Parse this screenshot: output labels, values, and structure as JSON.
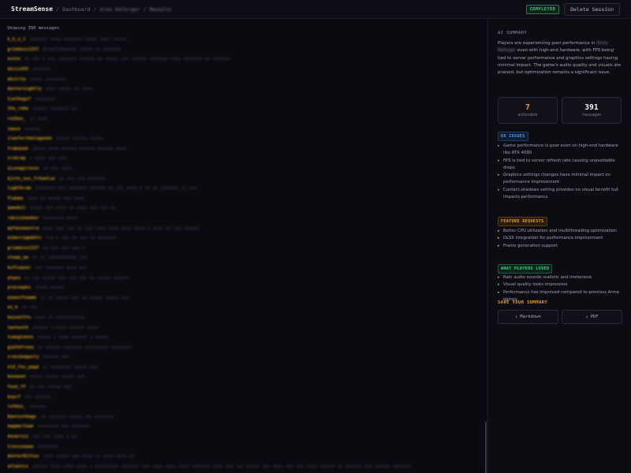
{
  "header": {
    "brand": "StreamSense",
    "crumbs": [
      "Dashboard",
      "Arma Reforger",
      "Results"
    ],
    "status_badge": "COMPLETED",
    "delete_label": "Delete Session"
  },
  "messages_panel": {
    "showing_label": "Showing 390 messages",
    "messages": [
      {
        "user": "b_h_u_t",
        "text": "xxxxxxx xxxx xxxxxxx xxxxx xxxx xxxxx"
      },
      {
        "user": "grimboxs1337",
        "text": "@lowfrequency xxxxx xx xxxxxxx"
      },
      {
        "user": "usnto",
        "text": "xx xxx x xxx xxxxxxx xxxxxx xx xxxxx xxx xxxxxx xxxxxxx xxxx xxxxxxx xx xxxxxxx"
      },
      {
        "user": "ekiss429",
        "text": "xxxxxxx"
      },
      {
        "user": "mhitrte",
        "text": "xxxxx xxxxxxxx"
      },
      {
        "user": "dexternightly",
        "text": "xxxx xxxxx xx xxxx"
      },
      {
        "user": "tiethegiT",
        "text": "xxxxxxxx"
      },
      {
        "user": "the_rube",
        "text": "xxxxxx xxxxxxx xx"
      },
      {
        "user": "ruthez_",
        "text": "xx xxxx"
      },
      {
        "user": "cmaze",
        "text": "xxxxxx"
      },
      {
        "user": "clanforthelegends",
        "text": "xxxxx xxxxxx xxxxx"
      },
      {
        "user": "frakenek",
        "text": "xxxxx xxxx xxxxxx xxxxxx xxxxxx xxxx"
      },
      {
        "user": "crzkrap",
        "text": "x xxxx xxx xxx"
      },
      {
        "user": "iLovegirzxxx",
        "text": "xx xxx xxxx"
      },
      {
        "user": "bjstn_sos_frkeelza",
        "text": "xx xxx xxx xxxxxxx"
      },
      {
        "user": "lightkram",
        "text": "xxxxxxxx xxx xxxxxxx xxxxxx xx xxx xxxx x xx xx xxxxxxx xx xxx"
      },
      {
        "user": "flamaa",
        "text": "xxxx xx xxxxx xxx xxxx"
      },
      {
        "user": "aamobil",
        "text": "xxxxx xxx xxxx xx xxxx xxx xxx xx"
      },
      {
        "user": "rakisihanker",
        "text": "xxxxxxxx xxxx"
      },
      {
        "user": "apfanoeaxtra",
        "text": "xxxx xxx xxx xx xxx xxxx xxxx xxxx xxxx x xxxx xx xxx xxxxxx"
      },
      {
        "user": "eimecrogadnts",
        "text": "xxx x xxx xx xxx xx xxxxxxx"
      },
      {
        "user": "grimboxs1337",
        "text": "xx xxx xxx xxx x"
      },
      {
        "user": "steam_nm",
        "text": "xx xx xxxxxxxxxxx xxx"
      },
      {
        "user": "kofloaner",
        "text": "xxx xxxxxxx xxxx xxx"
      },
      {
        "user": "atayo",
        "text": "xx xxx xxxxx xxx xxx xxx xx xxxxx xxxxxx"
      },
      {
        "user": "prasnapks",
        "text": "xxxxx xxxxx"
      },
      {
        "user": "exmeiftemme",
        "text": "xx xx xxxxx xxx xx xxxxx xxxxx xxx"
      },
      {
        "user": "no_k",
        "text": "xx xxx"
      },
      {
        "user": "kainettts",
        "text": "xxxx xx xxxxxxxxxxx"
      },
      {
        "user": "tautooth",
        "text": "xxxxxx x xxxx xxxxxx xxxx"
      },
      {
        "user": "timeglenns",
        "text": "xxxxx x xxxx xxxxxx x xxxxx"
      },
      {
        "user": "gimfafrmxe",
        "text": "xx xxxxxx xxxxxxx xxxxxxxxx xxxxxxxx"
      },
      {
        "user": "crazikegasly",
        "text": "xxxxxx xxx"
      },
      {
        "user": "old_fox_page",
        "text": "xx xxxxxxxx xxxxx xxx"
      },
      {
        "user": "hunanen",
        "text": "xxxxx xxxxx xxxxx xxx"
      },
      {
        "user": "fuze_ff",
        "text": "xx xxx xxxxx xxx"
      },
      {
        "user": "koarf",
        "text": "xxx xxxxxx"
      },
      {
        "user": "ruthez_",
        "text": "xxxxxx"
      },
      {
        "user": "Kantinthegs",
        "text": "xx xxxxxxx xxxxx xxx xxxxxxx"
      },
      {
        "user": "magamrtoan",
        "text": "xxxxxxxx xxx xxxxxxx"
      },
      {
        "user": "dunarsii",
        "text": "xxx xxx xxxx x xx"
      },
      {
        "user": "trevinoman",
        "text": "xxxxxxxx"
      },
      {
        "user": "dexterBitlez",
        "text": "xxxx xxxxx xxx xxxx xx xxxx xxxx xx"
      },
      {
        "user": "atlantis",
        "text": "xxxxxx xxxx xxxx xxxx x xxxxxxxxx xxxxxxx xxx xxxx xxxx xxxx xxxxxxx xxxx xxx xxx xxxxx xxx xxxx xxx xxx xxxx xxxxxx xx xxxxxx xxx xxxxxx xxxxxxx"
      },
      {
        "user": "",
        "text": "xxxx xxxx xxx xxxxxx xx xxxxxxx xxxxx xxx xxx xxxx xxxxxx xxxxxx xxx xxxx xxx xxxx xxxxx xxxxxxx"
      }
    ]
  },
  "sidebar": {
    "ai_title": "AI SUMMARY",
    "summary_pre": "Players are experiencing poor performance in ",
    "summary_blur": "Arma Reforger",
    "summary_post": " even with high-end hardware, with FPS being tied to server performance and graphics settings having minimal impact. The game's audio quality and visuals are praised, but optimization remains a significant issue.",
    "stats": [
      {
        "value": "7",
        "label": "actionable",
        "color": "#f0a020"
      },
      {
        "value": "391",
        "label": "messages",
        "color": "#f2f2f2"
      }
    ],
    "ux_title": "UX ISSUES",
    "ux_items": [
      "Game performance is poor even on high-end hardware like RTX 4090",
      "FPS is tied to server refresh rate causing unavoidable drops",
      "Graphics settings changes have minimal impact on performance improvement",
      "Contact shadows setting provides no visual benefit but impacts performance"
    ],
    "feat_title": "FEATURE REQUESTS",
    "feat_items": [
      "Better CPU utilization and multithreading optimization",
      "DLSS integration for performance improvement",
      "Frame generation support"
    ],
    "loved_title": "WHAT PLAYERS LOVED",
    "loved_items": [
      "Rain audio sounds realistic and immersive",
      "Visual quality looks impressive",
      "Performance has improved compared to previous Arma games"
    ],
    "save_title": "SAVE YOUR SUMMARY",
    "markdown_label": "Markdown",
    "pdf_label": "PDF",
    "download_glyph": "↓"
  },
  "colors": {
    "accent_orange": "#f0a020",
    "accent_green": "#32d782",
    "accent_blue": "#4aa3ff"
  }
}
